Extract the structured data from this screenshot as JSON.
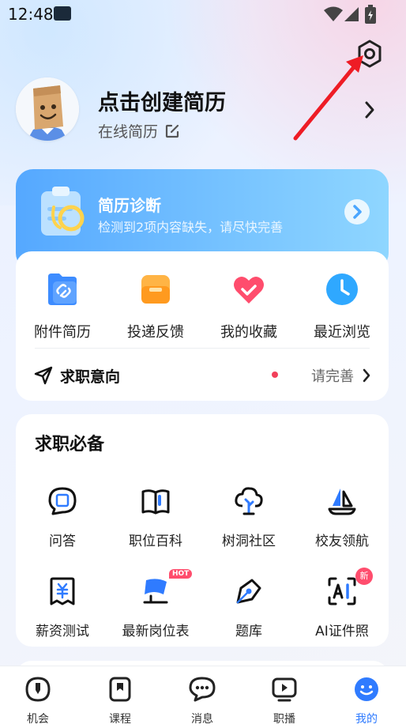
{
  "status_bar": {
    "time": "12:48"
  },
  "profile": {
    "title": "点击创建简历",
    "subtitle": "在线简历"
  },
  "diagnosis": {
    "title": "简历诊断",
    "subtitle": "检测到2项内容缺失，请尽快完善"
  },
  "quick_actions": [
    {
      "label": "附件简历",
      "icon": "attachment-resume-icon",
      "color": "#3d8cff"
    },
    {
      "label": "投递反馈",
      "icon": "delivery-feedback-icon",
      "color": "#ffa42e"
    },
    {
      "label": "我的收藏",
      "icon": "favorites-heart-icon",
      "color": "#ff4d6d"
    },
    {
      "label": "最近浏览",
      "icon": "recent-clock-icon",
      "color": "#2fa8ff"
    }
  ],
  "job_intent": {
    "label": "求职意向",
    "status": "请完善"
  },
  "essentials": {
    "title": "求职必备",
    "items": [
      {
        "label": "问答",
        "icon": "qa-bubble-icon"
      },
      {
        "label": "职位百科",
        "icon": "book-icon"
      },
      {
        "label": "树洞社区",
        "icon": "tree-icon"
      },
      {
        "label": "校友领航",
        "icon": "sailboat-icon"
      },
      {
        "label": "薪资测试",
        "icon": "salary-icon"
      },
      {
        "label": "最新岗位表",
        "icon": "flag-icon",
        "badge": "HOT"
      },
      {
        "label": "题库",
        "icon": "pen-icon"
      },
      {
        "label": "AI证件照",
        "icon": "ai-photo-icon",
        "badge": "新"
      }
    ]
  },
  "tabs": [
    {
      "label": "机会",
      "icon": "opportunity-icon"
    },
    {
      "label": "课程",
      "icon": "course-icon"
    },
    {
      "label": "消息",
      "icon": "message-icon"
    },
    {
      "label": "职播",
      "icon": "live-icon"
    },
    {
      "label": "我的",
      "icon": "me-icon",
      "active": true
    }
  ],
  "colors": {
    "accent": "#2f7bff",
    "badge": "#ff4d6d",
    "annotation_arrow": "#ee1c25"
  }
}
